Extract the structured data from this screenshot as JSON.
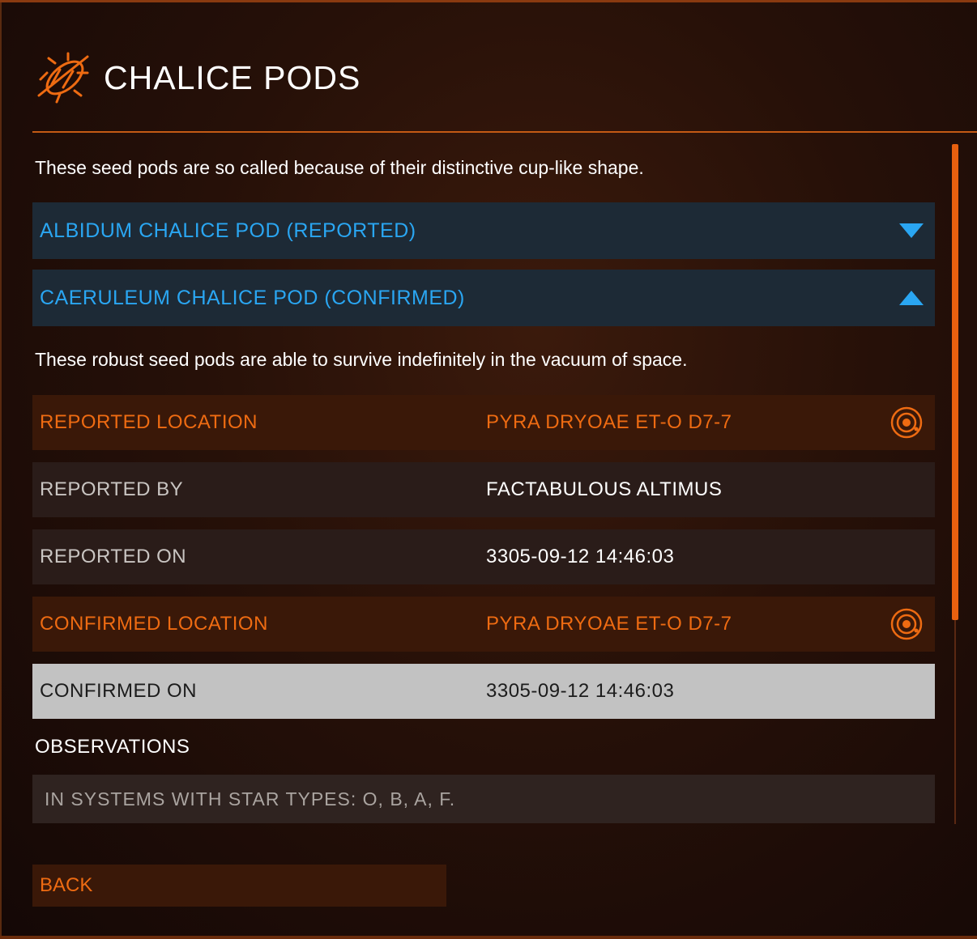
{
  "header": {
    "title": "CHALICE PODS",
    "icon": "chalice-pod-icon"
  },
  "intro": "These seed pods are so called because of their distinctive cup-like shape.",
  "accordion": [
    {
      "label": "ALBIDUM CHALICE POD (REPORTED)",
      "state": "collapsed"
    },
    {
      "label": "CAERULEUM CHALICE POD (CONFIRMED)",
      "state": "expanded"
    }
  ],
  "detail": {
    "description": "These robust seed pods are able to survive indefinitely in the vacuum of space.",
    "rows": [
      {
        "key": "REPORTED LOCATION",
        "value": "PYRA DRYOAE ET-O D7-7",
        "icon": "target-icon"
      },
      {
        "key": "REPORTED BY",
        "value": "FACTABULOUS ALTIMUS"
      },
      {
        "key": "REPORTED ON",
        "value": "3305-09-12  14:46:03"
      },
      {
        "key": "CONFIRMED LOCATION",
        "value": "PYRA DRYOAE ET-O D7-7",
        "icon": "target-icon"
      },
      {
        "key": "CONFIRMED ON",
        "value": "3305-09-12  14:46:03"
      }
    ],
    "observations_title": "OBSERVATIONS",
    "observations": "IN SYSTEMS WITH STAR TYPES: O, B, A, F."
  },
  "back_label": "BACK",
  "colors": {
    "accent": "#ee6b12",
    "blue": "#2aa6f2",
    "highlight": "#c2c2c2"
  }
}
